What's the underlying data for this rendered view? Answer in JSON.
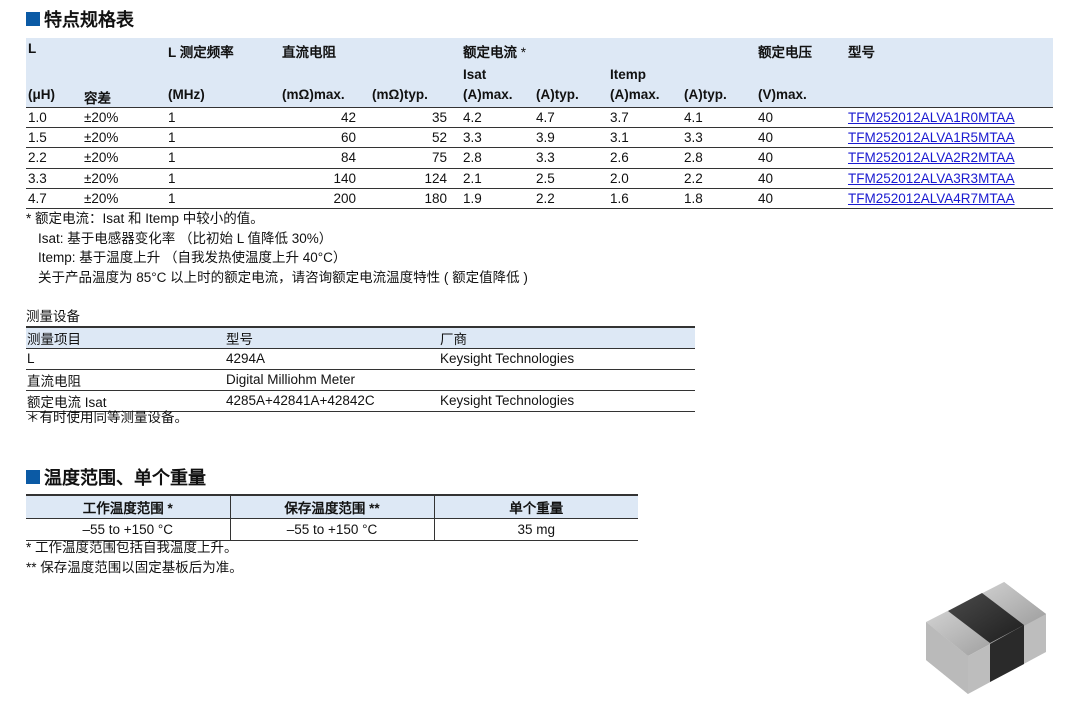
{
  "section1": {
    "title": "特点规格表"
  },
  "spec_table": {
    "header": {
      "L": "L",
      "freq": "L 测定频率",
      "dcr": "直流电阻",
      "rated_current": "额定电流",
      "asterisk": "*",
      "rated_voltage": "额定电压",
      "part_no": "型号",
      "isat": "Isat",
      "itemp": "Itemp",
      "units": [
        "(μH)",
        "容差",
        "(MHz)",
        "(mΩ)max.",
        "(mΩ)typ.",
        "(A)max.",
        "(A)typ.",
        "(A)max.",
        "(A)typ.",
        "(V)max."
      ]
    },
    "rows": [
      [
        "1.0",
        "±20%",
        "1",
        "42",
        "35",
        "4.2",
        "4.7",
        "3.7",
        "4.1",
        "40",
        "TFM252012ALVA1R0MTAA"
      ],
      [
        "1.5",
        "±20%",
        "1",
        "60",
        "52",
        "3.3",
        "3.9",
        "3.1",
        "3.3",
        "40",
        "TFM252012ALVA1R5MTAA"
      ],
      [
        "2.2",
        "±20%",
        "1",
        "84",
        "75",
        "2.8",
        "3.3",
        "2.6",
        "2.8",
        "40",
        "TFM252012ALVA2R2MTAA"
      ],
      [
        "3.3",
        "±20%",
        "1",
        "140",
        "124",
        "2.1",
        "2.5",
        "2.0",
        "2.2",
        "40",
        "TFM252012ALVA3R3MTAA"
      ],
      [
        "4.7",
        "±20%",
        "1",
        "200",
        "180",
        "1.9",
        "2.2",
        "1.6",
        "1.8",
        "40",
        "TFM252012ALVA4R7MTAA"
      ]
    ]
  },
  "spec_notes": [
    "* 额定电流：Isat 和 Itemp 中较小的值。",
    "Isat: 基于电感器变化率 （比初始 L 值降低 30%）",
    "Itemp: 基于温度上升 （自我发热使温度上升 40°C）",
    "关于产品温度为 85°C 以上时的额定电流，请咨询额定电流温度特性 ( 额定值降低 )"
  ],
  "measurement": {
    "title": "测量设备",
    "headers": [
      "测量项目",
      "型号",
      "厂商"
    ],
    "rows": [
      [
        "L",
        "4294A",
        "Keysight Technologies"
      ],
      [
        "直流电阻",
        "Digital Milliohm Meter",
        ""
      ],
      [
        "额定电流 Isat",
        "4285A+42841A+42842C",
        "Keysight Technologies"
      ]
    ],
    "note": "＊有时使用同等测量设备。"
  },
  "section2": {
    "title": "温度范围、单个重量"
  },
  "temp_table": {
    "headers": [
      "工作温度范围 *",
      "保存温度范围 **",
      "单个重量"
    ],
    "values": [
      "–55 to +150 °C",
      "–55 to +150 °C",
      "35 mg"
    ]
  },
  "temp_notes": [
    "*  工作温度范围包括自我温度上升。",
    "** 保存温度范围以固定基板后为准。"
  ],
  "colors": {
    "accent": "#0b5aa5",
    "header_bg": "#dde8f5",
    "link": "#1a1ad0"
  },
  "image": {
    "icon": "inductor-chip-icon"
  }
}
